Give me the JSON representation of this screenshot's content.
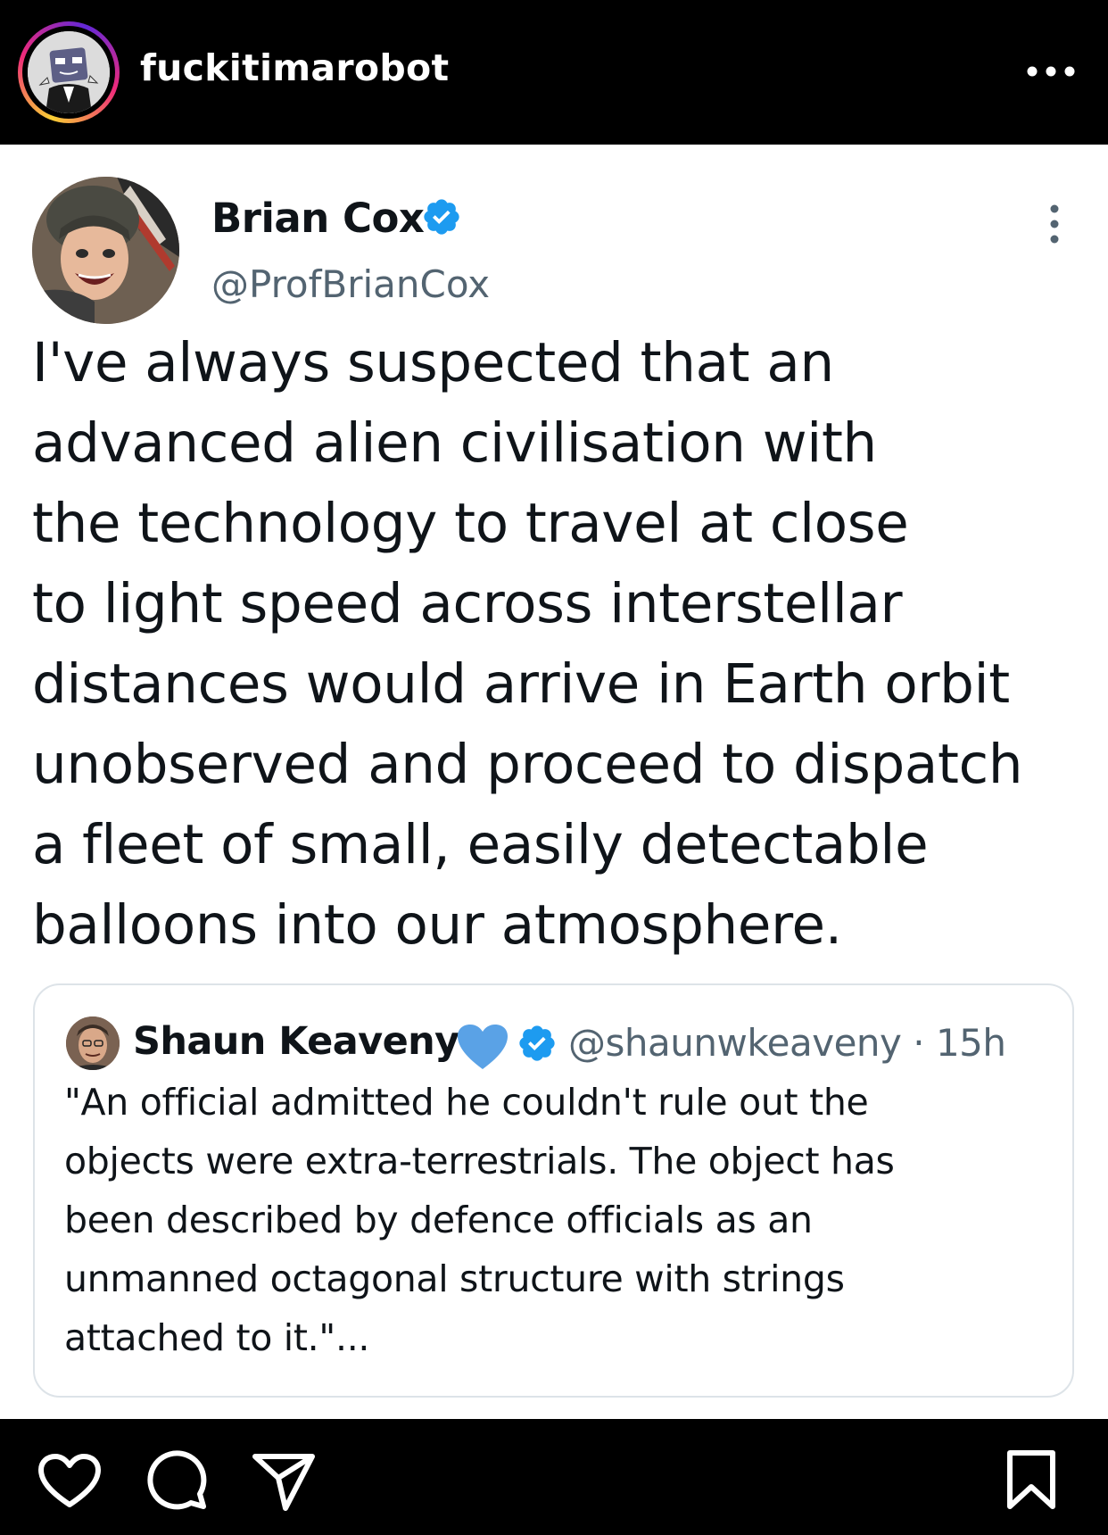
{
  "instagram": {
    "username": "fuckitimarobot",
    "avatar_icon": "robot-avatar-icon",
    "more_icon": "more-horizontal-icon",
    "actions": {
      "like_icon": "heart-icon",
      "comment_icon": "comment-icon",
      "share_icon": "send-icon",
      "save_icon": "bookmark-icon"
    }
  },
  "tweet": {
    "author_name": "Brian Cox",
    "author_handle": "@ProfBrianCox",
    "verified": true,
    "text": "I've always suspected that an\nadvanced alien civilisation with\nthe technology to travel at close\nto light speed across interstellar\ndistances would arrive in Earth orbit\nunobserved and proceed to dispatch\na fleet of small, easily detectable\nballoons into our atmosphere.",
    "quoted": {
      "author_name": "Shaun Keaveny",
      "author_handle_time": "@shaunwkeaveny · 15h",
      "verified": true,
      "text": "\"An official admitted he couldn't rule out the\nobjects were extra-terrestrials. The object has\nbeen described by defence officials as an\nunmanned octagonal structure with strings\nattached to it.\"..."
    }
  },
  "colors": {
    "twitter_blue": "#1d9bf0",
    "heart_blue": "#5aa2e6",
    "text_primary": "#0f1419",
    "text_secondary": "#536471"
  }
}
